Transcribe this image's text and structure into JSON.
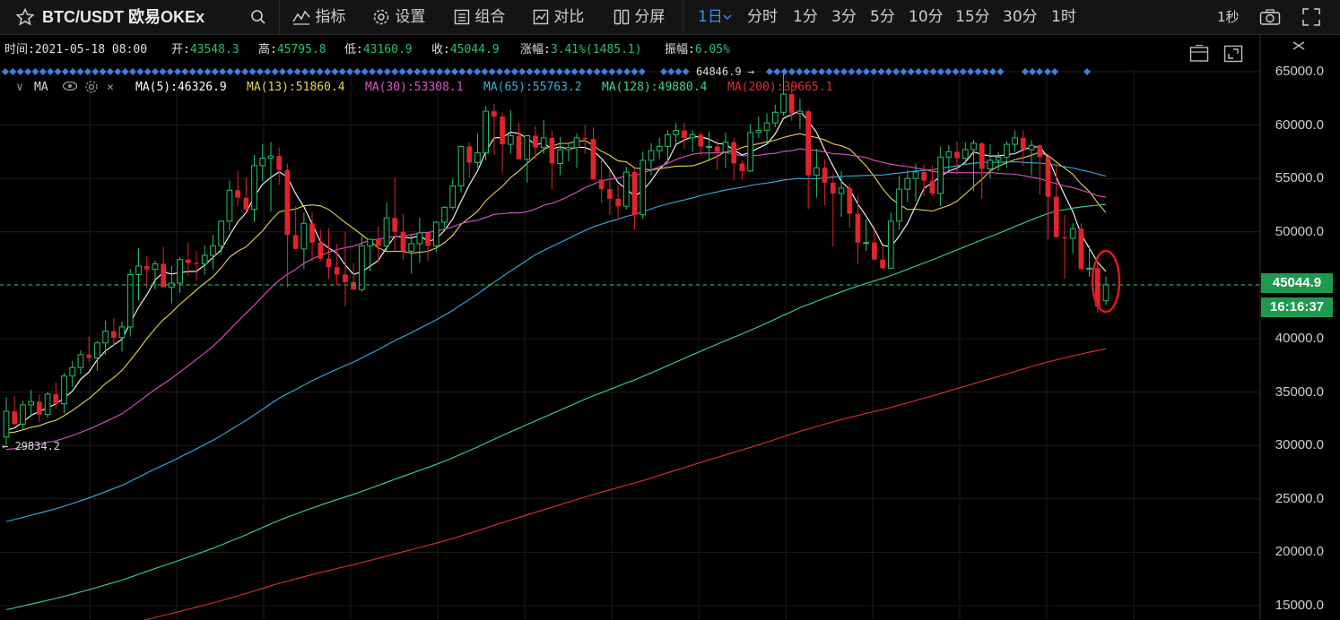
{
  "toolbar": {
    "symbol": "BTC/USDT 欧易OKEx",
    "indicators_label": "指标",
    "settings_label": "设置",
    "combo_label": "组合",
    "compare_label": "对比",
    "split_label": "分屏",
    "intervals": [
      "1日",
      "分时",
      "1分",
      "3分",
      "5分",
      "10分",
      "15分",
      "30分",
      "1时"
    ],
    "active_interval": "1日",
    "refresh_label": "1秒"
  },
  "ohlc": {
    "time_label": "时间:",
    "time": "2021-05-18 08:00",
    "open_label": "开:",
    "open": "43548.3",
    "high_label": "高:",
    "high": "45795.8",
    "low_label": "低:",
    "low": "43160.9",
    "close_label": "收:",
    "close": "45044.9",
    "change_label": "涨幅:",
    "change": "3.41%(1485.1)",
    "amp_label": "振幅:",
    "amp": "6.05%"
  },
  "ma_legend": {
    "title": "MA",
    "items": [
      {
        "label": "MA(5):46326.9",
        "color": "#ffffff"
      },
      {
        "label": "MA(13):51860.4",
        "color": "#e8d44d"
      },
      {
        "label": "MA(30):53308.1",
        "color": "#e052c8"
      },
      {
        "label": "MA(65):55763.2",
        "color": "#3aaee0"
      },
      {
        "label": "MA(128):49880.4",
        "color": "#3fd68a"
      },
      {
        "label": "MA(200):39665.1",
        "color": "#e0302c"
      }
    ]
  },
  "chart_data": {
    "type": "candlestick",
    "symbol": "BTC/USDT",
    "interval": "1日",
    "ylim": [
      15000,
      67000
    ],
    "y_ticks": [
      "65000.0",
      "60000.0",
      "55000.0",
      "50000.0",
      "45000.0",
      "40000.0",
      "35000.0",
      "30000.0",
      "25000.0",
      "20000.0",
      "15000.0"
    ],
    "current_price": "45044.9",
    "countdown": "16:16:37",
    "max_marker": "64846.9",
    "min_marker": "29834.2",
    "candles": [
      [
        30800,
        34500,
        29834,
        33200
      ],
      [
        33200,
        34600,
        31900,
        32000
      ],
      [
        32000,
        34200,
        31500,
        33800
      ],
      [
        33800,
        35200,
        32700,
        34100
      ],
      [
        34100,
        34800,
        32200,
        32900
      ],
      [
        32900,
        35000,
        32600,
        34800
      ],
      [
        34800,
        35900,
        33400,
        33900
      ],
      [
        33900,
        36800,
        33000,
        36500
      ],
      [
        36500,
        37900,
        35500,
        37300
      ],
      [
        37300,
        38900,
        36700,
        38500
      ],
      [
        38500,
        40200,
        37800,
        38200
      ],
      [
        38200,
        39800,
        37000,
        39600
      ],
      [
        39600,
        41700,
        38500,
        40700
      ],
      [
        40700,
        41900,
        39400,
        40100
      ],
      [
        40100,
        41600,
        38800,
        41100
      ],
      [
        41100,
        46500,
        40200,
        46000
      ],
      [
        46000,
        48500,
        43600,
        46800
      ],
      [
        46800,
        47700,
        44700,
        46500
      ],
      [
        46500,
        47300,
        44600,
        47000
      ],
      [
        47000,
        48600,
        45400,
        44800
      ],
      [
        44800,
        46800,
        43300,
        45200
      ],
      [
        45200,
        47600,
        44300,
        47400
      ],
      [
        47400,
        49000,
        45900,
        47100
      ],
      [
        47100,
        48200,
        45400,
        47000
      ],
      [
        47000,
        48700,
        46000,
        47800
      ],
      [
        47800,
        49700,
        46500,
        48700
      ],
      [
        48700,
        50800,
        47900,
        51000
      ],
      [
        51000,
        54800,
        50100,
        53900
      ],
      [
        53900,
        55700,
        52400,
        53200
      ],
      [
        53200,
        55100,
        51800,
        52100
      ],
      [
        52100,
        57200,
        50900,
        56200
      ],
      [
        56200,
        58200,
        54700,
        56900
      ],
      [
        56900,
        58400,
        51900,
        57100
      ],
      [
        57100,
        57900,
        54400,
        55800
      ],
      [
        55800,
        56400,
        44800,
        49700
      ],
      [
        49700,
        52400,
        48700,
        48400
      ],
      [
        48400,
        51800,
        46500,
        50800
      ],
      [
        50800,
        51800,
        47200,
        49000
      ],
      [
        49000,
        50200,
        47300,
        47500
      ],
      [
        47500,
        50300,
        45600,
        46700
      ],
      [
        46700,
        48900,
        45000,
        46000
      ],
      [
        46000,
        50000,
        43000,
        45300
      ],
      [
        45300,
        47100,
        44700,
        44600
      ],
      [
        44600,
        49600,
        44400,
        48700
      ],
      [
        48700,
        49400,
        46300,
        49300
      ],
      [
        49300,
        50500,
        47200,
        48700
      ],
      [
        48700,
        52700,
        48100,
        51300
      ],
      [
        51300,
        55100,
        48200,
        50000
      ],
      [
        50000,
        51700,
        47400,
        48200
      ],
      [
        48200,
        49700,
        46100,
        48900
      ],
      [
        48900,
        51300,
        47100,
        49900
      ],
      [
        49900,
        50000,
        47300,
        48700
      ],
      [
        48700,
        51000,
        48100,
        50900
      ],
      [
        50900,
        52400,
        50400,
        52300
      ],
      [
        52300,
        55000,
        52100,
        54300
      ],
      [
        54300,
        58000,
        53700,
        58000
      ],
      [
        58000,
        58400,
        55100,
        56500
      ],
      [
        56500,
        59200,
        56000,
        57400
      ],
      [
        57400,
        61800,
        56700,
        61300
      ],
      [
        61300,
        62000,
        57200,
        60800
      ],
      [
        60800,
        61200,
        55500,
        58200
      ],
      [
        58200,
        61400,
        57300,
        59000
      ],
      [
        59000,
        60200,
        57800,
        56800
      ],
      [
        56800,
        59100,
        54600,
        59000
      ],
      [
        59000,
        59900,
        56800,
        57900
      ],
      [
        57900,
        60500,
        57300,
        58800
      ],
      [
        58800,
        59500,
        54000,
        56400
      ],
      [
        56400,
        58900,
        55300,
        57700
      ],
      [
        57700,
        58300,
        56600,
        57900
      ],
      [
        57900,
        59200,
        56000,
        58800
      ],
      [
        58800,
        60000,
        57300,
        58700
      ],
      [
        58700,
        59800,
        55200,
        54900
      ],
      [
        54900,
        56800,
        52700,
        54000
      ],
      [
        54000,
        55800,
        51600,
        53100
      ],
      [
        53100,
        54300,
        51300,
        52400
      ],
      [
        52400,
        56100,
        52100,
        55600
      ],
      [
        55600,
        55900,
        50200,
        51600
      ],
      [
        51600,
        57500,
        51200,
        56700
      ],
      [
        56700,
        58300,
        55300,
        57600
      ],
      [
        57600,
        58800,
        56800,
        58000
      ],
      [
        58000,
        59500,
        56600,
        59100
      ],
      [
        59100,
        60200,
        58200,
        59500
      ],
      [
        59500,
        60200,
        57800,
        58800
      ],
      [
        58800,
        59500,
        57500,
        59100
      ],
      [
        59100,
        59400,
        57100,
        58000
      ],
      [
        58000,
        59400,
        56600,
        58000
      ],
      [
        58000,
        58700,
        55800,
        57500
      ],
      [
        57500,
        59300,
        56000,
        58400
      ],
      [
        58400,
        58800,
        54800,
        56400
      ],
      [
        56400,
        56700,
        54900,
        55700
      ],
      [
        55700,
        60100,
        55600,
        59300
      ],
      [
        59300,
        60800,
        58800,
        59500
      ],
      [
        59500,
        61100,
        58200,
        60200
      ],
      [
        60200,
        61900,
        59800,
        61200
      ],
      [
        61200,
        64846,
        60900,
        62900
      ],
      [
        62900,
        63800,
        60400,
        61100
      ],
      [
        61100,
        62500,
        59600,
        61300
      ],
      [
        61300,
        61500,
        52100,
        55300
      ],
      [
        55300,
        57800,
        53200,
        56000
      ],
      [
        56000,
        56800,
        52500,
        54600
      ],
      [
        54600,
        55500,
        48600,
        53600
      ],
      [
        53600,
        55700,
        51400,
        54100
      ],
      [
        54100,
        54500,
        50400,
        51700
      ],
      [
        51700,
        53400,
        47000,
        49000
      ],
      [
        49000,
        51200,
        48200,
        49000
      ],
      [
        49000,
        50200,
        47600,
        47400
      ],
      [
        47400,
        48700,
        46500,
        46600
      ],
      [
        46600,
        51800,
        46600,
        51000
      ],
      [
        51000,
        55300,
        50200,
        54000
      ],
      [
        54000,
        55800,
        52800,
        55000
      ],
      [
        55000,
        56400,
        52900,
        55600
      ],
      [
        55600,
        56300,
        53400,
        54800
      ],
      [
        54800,
        56200,
        53400,
        53600
      ],
      [
        53600,
        58000,
        52400,
        57000
      ],
      [
        57000,
        58100,
        55700,
        57500
      ],
      [
        57500,
        58500,
        55400,
        56900
      ],
      [
        56900,
        58400,
        56300,
        57700
      ],
      [
        57700,
        58600,
        53800,
        58300
      ],
      [
        58300,
        58400,
        53100,
        55900
      ],
      [
        55900,
        58200,
        55000,
        56700
      ],
      [
        56700,
        57500,
        55700,
        57000
      ],
      [
        57000,
        58500,
        56000,
        58200
      ],
      [
        58200,
        59500,
        57500,
        58800
      ],
      [
        58800,
        59500,
        56200,
        57700
      ],
      [
        57700,
        58600,
        55300,
        58100
      ],
      [
        58100,
        58200,
        53500,
        57000
      ],
      [
        57000,
        57300,
        49300,
        53300
      ],
      [
        53300,
        56400,
        50300,
        49500
      ],
      [
        49500,
        51600,
        45600,
        49400
      ],
      [
        49400,
        50800,
        48000,
        50300
      ],
      [
        50300,
        50800,
        48100,
        46500
      ],
      [
        46500,
        48700,
        45800,
        46600
      ],
      [
        46600,
        47700,
        42400,
        43000
      ],
      [
        43548,
        45796,
        43161,
        45045
      ]
    ]
  }
}
